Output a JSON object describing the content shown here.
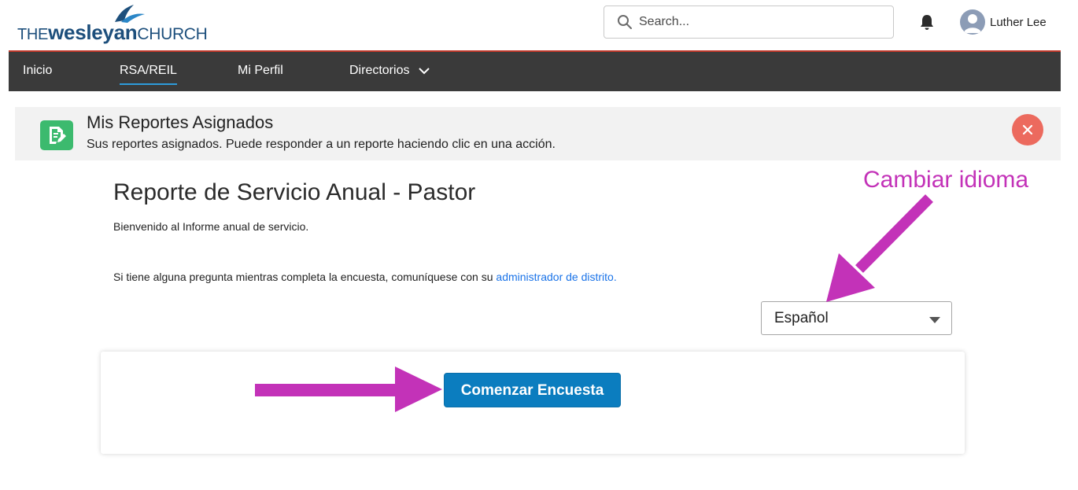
{
  "header": {
    "logo": {
      "the": "THE",
      "wesleyan": "wesleyan",
      "church": "CHURCH"
    },
    "search": {
      "placeholder": "Search..."
    },
    "icons": {
      "search": "search-icon",
      "bell": "bell-icon",
      "avatar": "user-avatar-icon"
    },
    "user_name": "Luther Lee"
  },
  "nav": {
    "items": [
      {
        "label": "Inicio",
        "active": false
      },
      {
        "label": "RSA/REIL",
        "active": true
      },
      {
        "label": "Mi Perfil",
        "active": false
      },
      {
        "label": "Directorios",
        "active": false,
        "has_dropdown": true
      }
    ]
  },
  "page_header": {
    "icon": "report-edit-icon",
    "title": "Mis Reportes Asignados",
    "subtitle": "Sus reportes asignados. Puede responder a un reporte haciendo clic en una acción.",
    "close_icon": "close-icon"
  },
  "report": {
    "title": "Reporte de Servicio Anual - Pastor",
    "welcome": "Bienvenido al Informe anual de servicio.",
    "question_text": "Si tiene alguna pregunta mientras completa la encuesta, comuníquese con su",
    "question_link": "administrador de distrito."
  },
  "language_select": {
    "selected": "Español"
  },
  "start_button": {
    "label": "Comenzar Encuesta"
  },
  "annotation": {
    "text": "Cambiar idioma"
  },
  "colors": {
    "nav_bg": "#3a3a3a",
    "nav_active_underline": "#2d9cdb",
    "brand_blue": "#1d4f7c",
    "primary_button": "#0b7dbf",
    "header_icon_green": "#3cba6e",
    "close_red": "#ec6a5e",
    "annotation_magenta": "#c332b8",
    "link_blue": "#1a73e8"
  }
}
